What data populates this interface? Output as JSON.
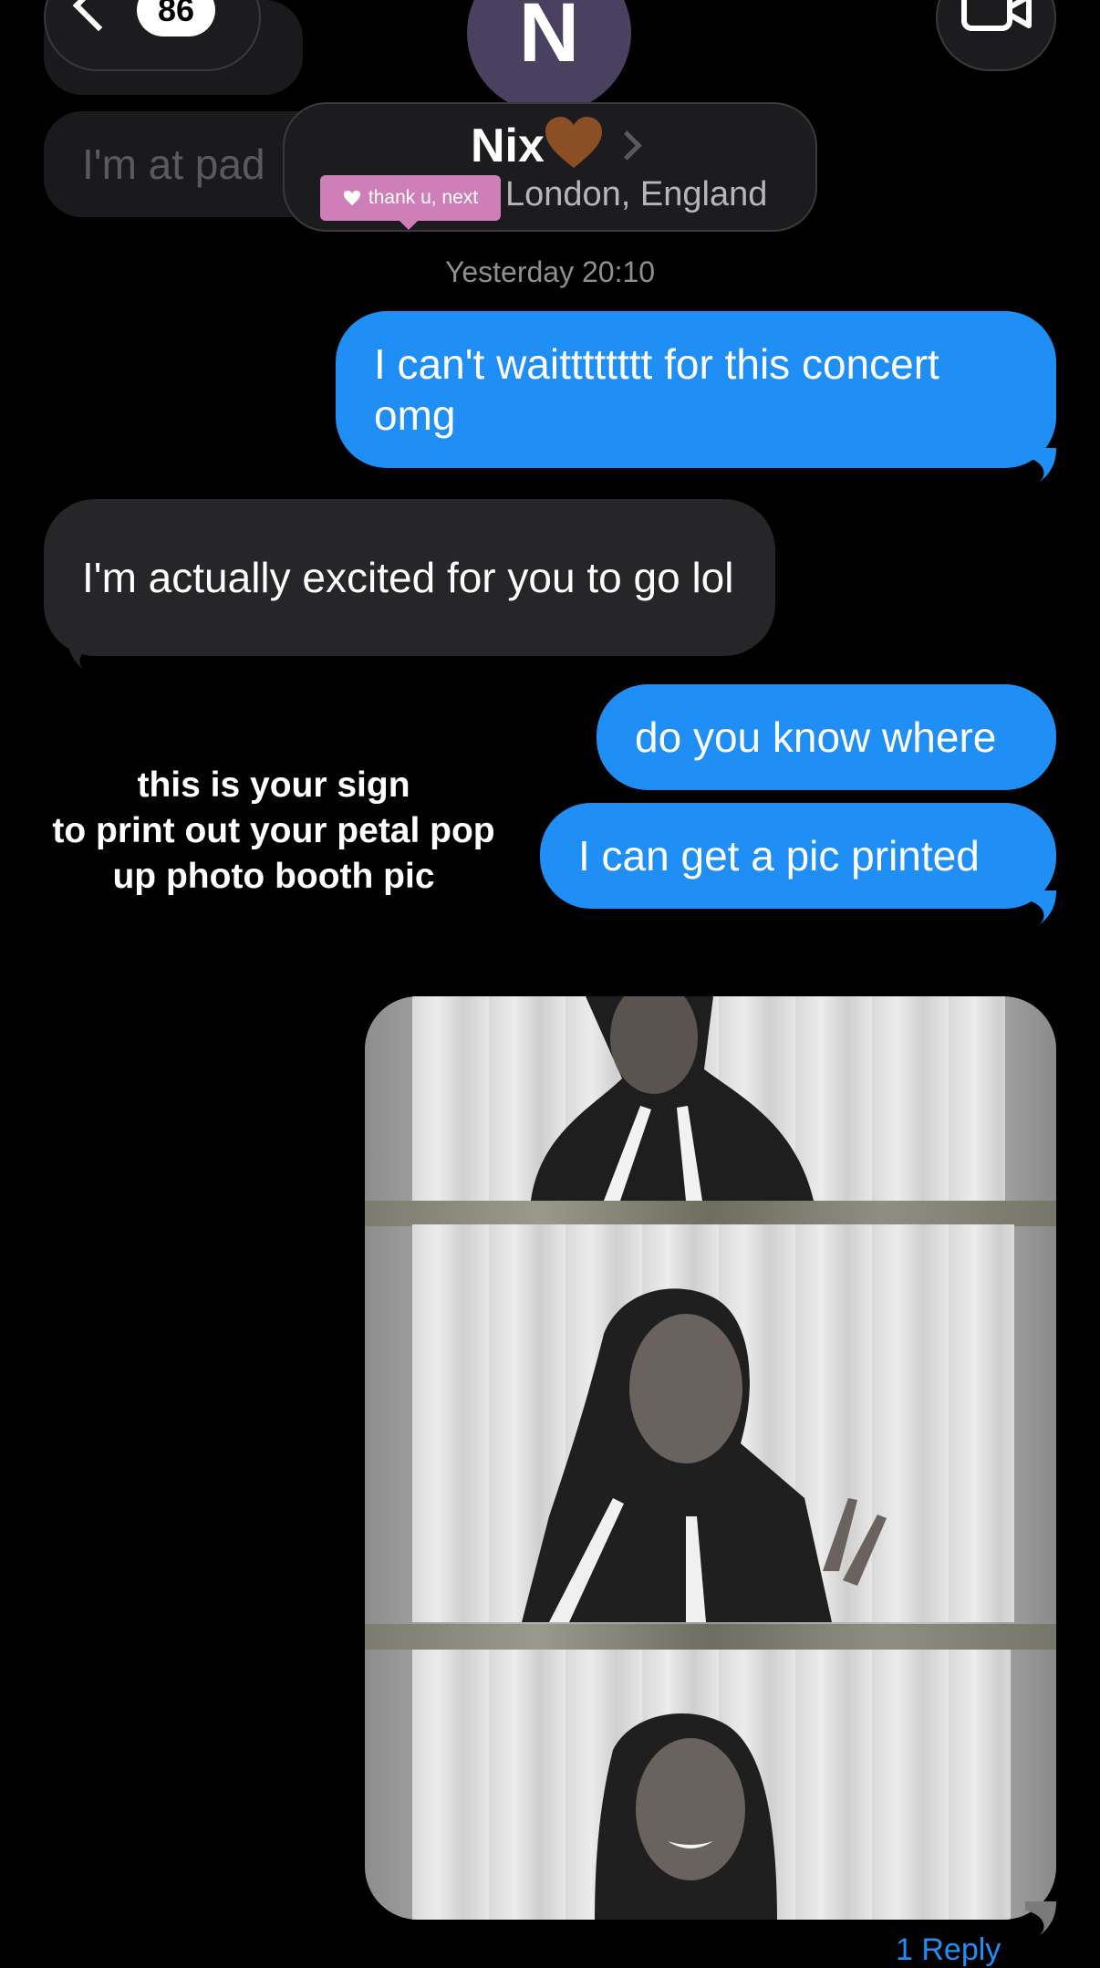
{
  "header": {
    "unread_count": "86",
    "avatar_initial": "N",
    "contact_name": "Nix",
    "contact_emoji": "brown-heart",
    "contact_location": "London, England",
    "song_tag": "thank u, next"
  },
  "background_messages": [
    {
      "text": "I'm at pad"
    }
  ],
  "thread": {
    "timestamp": "Yesterday 20:10",
    "messages": [
      {
        "direction": "sent",
        "text": "I can't waitttttttt for this concert omg"
      },
      {
        "direction": "received",
        "text": "I'm actually excited for you to go lol"
      },
      {
        "direction": "sent",
        "text": "do you know where"
      },
      {
        "direction": "sent",
        "text": "I can get a pic printed"
      }
    ],
    "reply_count_label": "1 Reply"
  },
  "overlay_caption": {
    "line1": "this is your sign",
    "line2": "to print out your petal pop",
    "line3": "up photo booth pic"
  },
  "colors": {
    "sent_bubble": "#1f8ef5",
    "received_bubble": "#262629",
    "background": "#000000",
    "song_tag": "#cf7fb7",
    "avatar": "#4a4060"
  }
}
